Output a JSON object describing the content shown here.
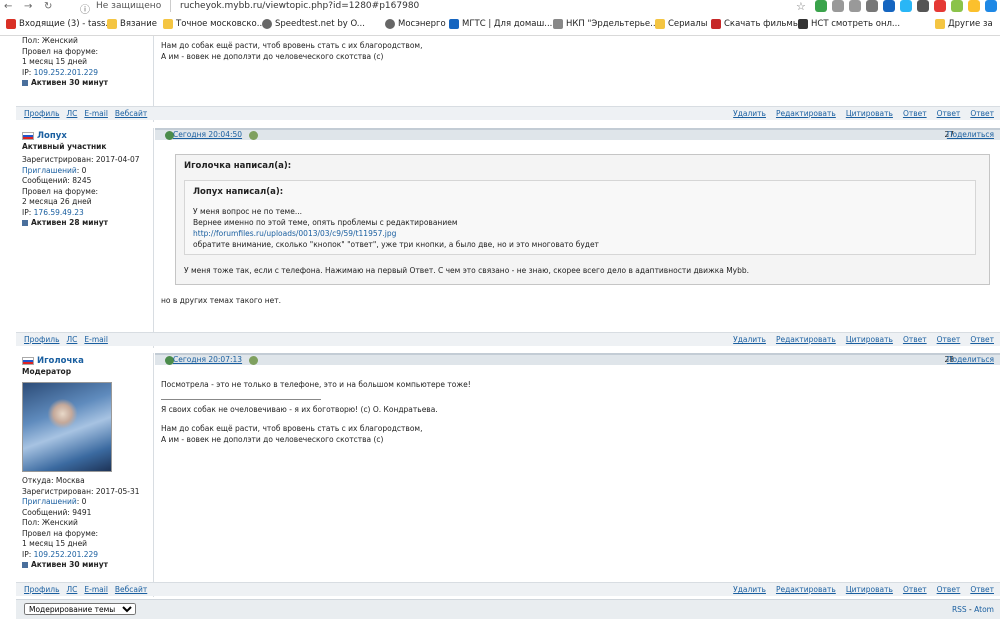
{
  "browser": {
    "not_secure": "Не защищено",
    "url": "rucheyok.mybb.ru/viewtopic.php?id=1280#p167980",
    "bookmarks": [
      {
        "label": "Входящие (3) - tass..."
      },
      {
        "label": "Вязание"
      },
      {
        "label": "Точное московско..."
      },
      {
        "label": "Speedtest.net by O..."
      },
      {
        "label": "Мосэнерго"
      },
      {
        "label": "МГТС | Для домаш..."
      },
      {
        "label": "НКП \"Эрдельтерье..."
      },
      {
        "label": "Сериалы"
      },
      {
        "label": "Скачать фильмы"
      },
      {
        "label": "НСТ смотреть онл..."
      },
      {
        "label": "Другие за"
      }
    ],
    "colors": {
      "accent": "#1a5fa0",
      "header": "#dfe5ea"
    }
  },
  "post0": {
    "sidebar": {
      "sex": "Пол: Женский",
      "forum_time_label": "Провел на форуме:",
      "forum_time": "1 месяц 15 дней",
      "ip_label": "IP:",
      "ip": "109.252.201.229",
      "active": "Активен 30 минут"
    },
    "body": [
      "Нам до собак ещё расти, чтоб вровень стать с их благородством,",
      "А им - вовек не дополэти до человеческого скотства (с)"
    ],
    "footer_left": [
      "Профиль",
      "ЛС",
      "E-mail",
      "Вебсайт"
    ],
    "footer_right": [
      "Удалить",
      "Редактировать",
      "Цитировать",
      "Ответ",
      "Ответ",
      "Ответ"
    ]
  },
  "post1": {
    "header": {
      "date": "Сегодня 20:04:50",
      "number": "27",
      "share": "Поделиться"
    },
    "sidebar": {
      "username": "Лопух",
      "title": "Активный участник",
      "registered": "Зарегистрирован: 2017-04-07",
      "invites_label": "Приглашений",
      "invites": ": 0",
      "messages": "Сообщений: 8245",
      "forum_time_label": "Провел на форуме:",
      "forum_time": "2 месяца 26 дней",
      "ip_label": "IP:",
      "ip": "176.59.49.23",
      "active": "Активен 28 минут"
    },
    "quote_outer_header": "Иголочка написал(а):",
    "quote_inner_header": "Лопух написал(а):",
    "quote_inner_lines": [
      "У меня вопрос не по теме...",
      "Вернее именно по этой теме,  опять проблемы с редактированием"
    ],
    "quote_inner_link": "http://forumfiles.ru/uploads/0013/03/c9/59/t11957.jpg",
    "quote_inner_last": "обратите внимание, сколько \"кнопок\" \"ответ\", уже три кнопки, а было две, но и это многовато будет",
    "quote_outer_text": "У меня тоже так, если с телефона. Нажимаю на первый Ответ. С чем это связано - не знаю, скорее всего дело в адаптивности движка Mybb.",
    "text": "но в других темах такого нет.",
    "footer_left": [
      "Профиль",
      "ЛС",
      "E-mail"
    ],
    "footer_right": [
      "Удалить",
      "Редактировать",
      "Цитировать",
      "Ответ",
      "Ответ",
      "Ответ"
    ]
  },
  "post2": {
    "header": {
      "date": "Сегодня 20:07:13",
      "number": "28",
      "share": "Поделиться"
    },
    "sidebar": {
      "username": "Иголочка",
      "title": "Модератор",
      "from": "Откуда: Москва",
      "registered": "Зарегистрирован: 2017-05-31",
      "invites_label": "Приглашений",
      "invites": ": 0",
      "messages": "Сообщений: 9491",
      "sex": "Пол: Женский",
      "forum_time_label": "Провел на форуме:",
      "forum_time": "1 месяц 15 дней",
      "ip_label": "IP:",
      "ip": "109.252.201.229",
      "active": "Активен 30 минут"
    },
    "body_line1": "Посмотрела - это не только в телефоне, это и на большом компьютере тоже!",
    "signature": [
      "Я своих собак не очеловечиваю - я их боготворю! (с) О. Кондратьева.",
      "Нам до собак ещё расти, чтоб вровень стать с их благородством,",
      "А им - вовек не дополэти до человеческого скотства (с)"
    ],
    "footer_left": [
      "Профиль",
      "ЛС",
      "E-mail",
      "Вебсайт"
    ],
    "footer_right": [
      "Удалить",
      "Редактировать",
      "Цитировать",
      "Ответ",
      "Ответ",
      "Ответ"
    ]
  },
  "bottom": {
    "moderation_select": "Модерирование темы",
    "rss": "RSS",
    "sep": " - ",
    "atom": "Atom"
  }
}
